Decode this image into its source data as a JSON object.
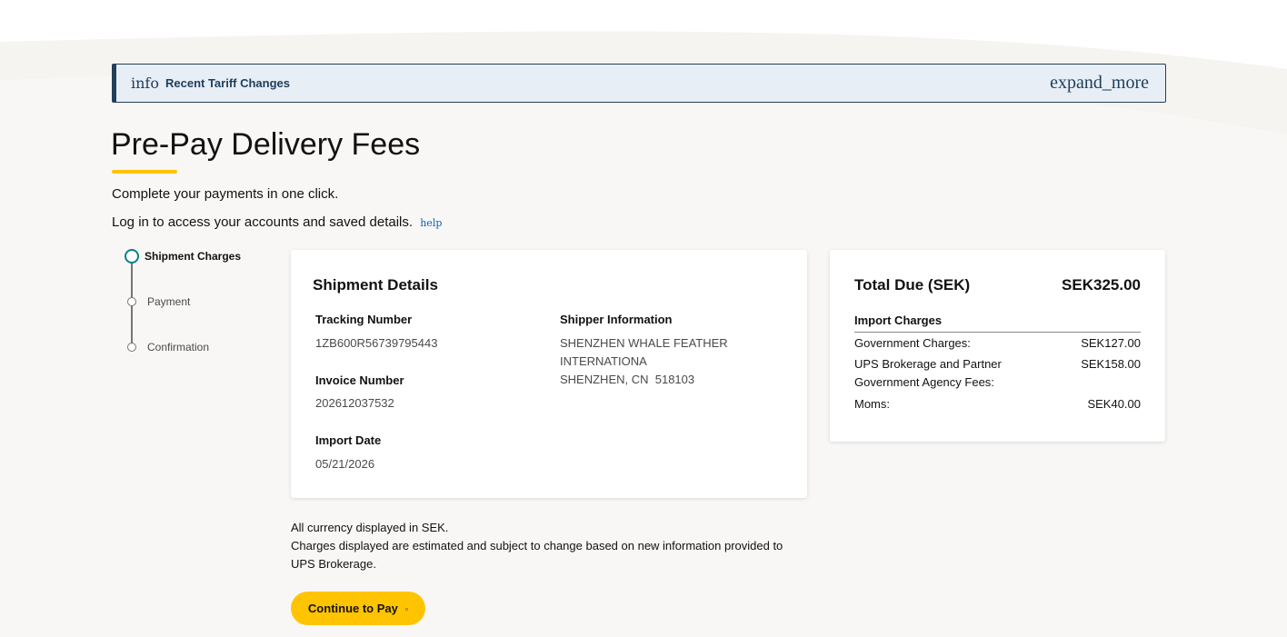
{
  "banner": {
    "icon": "info",
    "title": "Recent Tariff Changes",
    "expand_icon": "expand_more"
  },
  "page": {
    "title": "Pre-Pay Delivery Fees",
    "intro_line1": "Complete your payments in one click.",
    "intro_line2": "Log in to access your accounts and saved details.",
    "help_icon": "help"
  },
  "stepper": {
    "steps": [
      {
        "label": "Shipment Charges",
        "active": true
      },
      {
        "label": "Payment",
        "active": false
      },
      {
        "label": "Confirmation",
        "active": false
      }
    ]
  },
  "shipment": {
    "heading": "Shipment Details",
    "tracking_label": "Tracking Number",
    "tracking_value": "1ZB600R56739795443",
    "invoice_label": "Invoice Number",
    "invoice_value": "202612037532",
    "import_date_label": "Import Date",
    "import_date_value": "05/21/2026",
    "shipper_label": "Shipper Information",
    "shipper_line1": "SHENZHEN WHALE FEATHER",
    "shipper_line2": "INTERNATIONA",
    "shipper_line3": "SHENZHEN, CN  518103"
  },
  "totals": {
    "title": "Total Due (SEK)",
    "amount": "SEK325.00",
    "import_charges_label": "Import Charges",
    "charges": [
      {
        "name": "Government Charges:",
        "value": "SEK127.00"
      },
      {
        "name": "UPS Brokerage and Partner Government Agency Fees:",
        "value": "SEK158.00"
      },
      {
        "name": "Moms:",
        "value": "SEK40.00"
      }
    ]
  },
  "notes": {
    "line1": "All currency displayed in SEK.",
    "line2": "Charges displayed are estimated and subject to change based on new information provided to UPS Brokerage."
  },
  "cta": {
    "label": "Continue to Pay",
    "arrow_icon": "▫"
  },
  "colors": {
    "accent_yellow": "#ffc400",
    "banner_navy": "#23405b",
    "step_teal": "#0a8080",
    "help_blue": "#0662bb"
  }
}
